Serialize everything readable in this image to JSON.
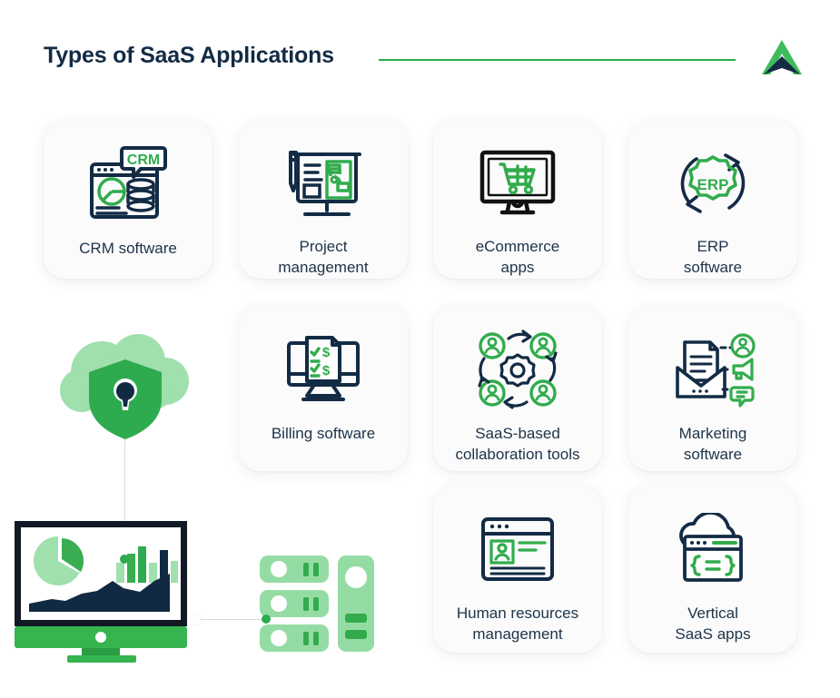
{
  "header": {
    "title": "Types of SaaS Applications",
    "rule_color": "#2eab4f",
    "logo_name": "brand-arrow-logo"
  },
  "theme": {
    "green": "#2eab4f",
    "green_light": "#9fe0ad",
    "green_mid": "#3fbb5c",
    "navy": "#132b44",
    "card_bg": "#fbfbfc",
    "page_bg": "#ffffff",
    "label_color": "#1d3348",
    "connector_gray": "#d8dce0"
  },
  "cards": [
    {
      "id": "crm-software",
      "label": "CRM software",
      "icon": "crm-window-icon",
      "row": 1,
      "col": 1
    },
    {
      "id": "project-management",
      "label": "Project\nmanagement",
      "icon": "presentation-board-icon",
      "row": 1,
      "col": 2
    },
    {
      "id": "ecommerce-apps",
      "label": "eCommerce\napps",
      "icon": "monitor-cart-icon",
      "row": 1,
      "col": 3
    },
    {
      "id": "erp-software",
      "label": "ERP\nsoftware",
      "icon": "erp-gear-cycle-icon",
      "row": 1,
      "col": 4
    },
    {
      "id": "billing-software",
      "label": "Billing software",
      "icon": "monitor-invoice-icon",
      "row": 2,
      "col": 2
    },
    {
      "id": "saas-collaboration",
      "label": "SaaS-based\ncollaboration tools",
      "icon": "team-gear-cycle-icon",
      "row": 2,
      "col": 3
    },
    {
      "id": "marketing-software",
      "label": "Marketing\nsoftware",
      "icon": "email-campaign-icon",
      "row": 2,
      "col": 4
    },
    {
      "id": "human-resources",
      "label": "Human resources\nmanagement",
      "icon": "profile-window-icon",
      "row": 3,
      "col": 3
    },
    {
      "id": "vertical-saas-apps",
      "label": "Vertical\nSaaS apps",
      "icon": "cloud-code-window-icon",
      "row": 3,
      "col": 4
    }
  ],
  "icon_text": {
    "crm_badge": "CRM",
    "erp_badge": "ERP",
    "code_badge": "{==}"
  },
  "illustration": {
    "cloud_shield": "cloud-shield-lock-illustration",
    "monitor": "analytics-monitor-illustration",
    "servers": "server-rack-illustration",
    "monitor_charts": [
      "pie-chart",
      "bar-chart",
      "area-chart"
    ]
  }
}
